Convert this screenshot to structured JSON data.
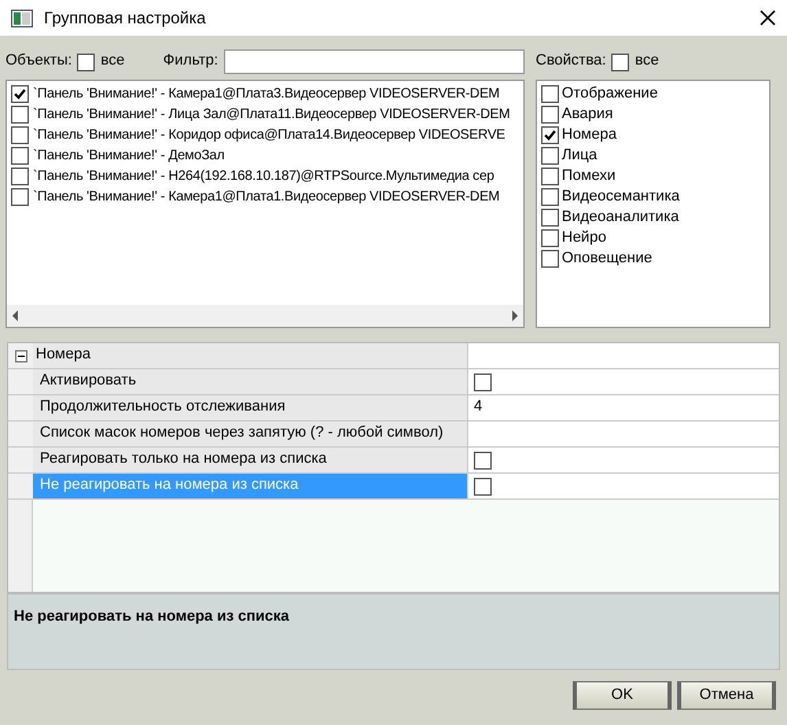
{
  "window": {
    "title": "Групповая настройка"
  },
  "objects": {
    "label": "Объекты:",
    "all_label": "все",
    "all_checked": false,
    "filter_label": "Фильтр:",
    "items": [
      {
        "label": "`Панель 'Внимание!' - Камера1@Плата3.Видеосервер VIDEOSERVER-DEM",
        "checked": true
      },
      {
        "label": "`Панель 'Внимание!' - Лица Зал@Плата11.Видеосервер VIDEOSERVER-DEM",
        "checked": false
      },
      {
        "label": "`Панель 'Внимание!' - Коридор офиса@Плата14.Видеосервер VIDEOSERVE",
        "checked": false
      },
      {
        "label": "`Панель 'Внимание!' - ДемоЗал",
        "checked": false
      },
      {
        "label": "`Панель 'Внимание!' - H264(192.168.10.187)@RTPSource.Мультимедиа сер",
        "checked": false
      },
      {
        "label": "`Панель 'Внимание!' - Камера1@Плата1.Видеосервер VIDEOSERVER-DEM",
        "checked": false
      }
    ]
  },
  "properties": {
    "label": "Свойства:",
    "all_label": "все",
    "all_checked": false,
    "items": [
      {
        "label": "Отображение",
        "checked": false
      },
      {
        "label": "Авария",
        "checked": false
      },
      {
        "label": "Номера",
        "checked": true
      },
      {
        "label": "Лица",
        "checked": false
      },
      {
        "label": "Помехи",
        "checked": false
      },
      {
        "label": "Видеосемантика",
        "checked": false
      },
      {
        "label": "Видеоаналитика",
        "checked": false
      },
      {
        "label": "Нейро",
        "checked": false
      },
      {
        "label": "Оповещение",
        "checked": false
      }
    ]
  },
  "property_grid": {
    "category": {
      "label": "Номера",
      "expanded": true
    },
    "rows": [
      {
        "name": "Активировать",
        "kind": "checkbox",
        "checked": false,
        "selected": false
      },
      {
        "name": "Продолжительность отслеживания",
        "kind": "text",
        "value": "4",
        "selected": false
      },
      {
        "name": "Список масок номеров через запятую (? - любой символ)",
        "kind": "text",
        "selected": false
      },
      {
        "name": "Реагировать только на номера из списка",
        "kind": "checkbox",
        "checked": false,
        "selected": false
      },
      {
        "name": "Не реагировать на номера из списка",
        "kind": "checkbox",
        "checked": false,
        "selected": true
      }
    ]
  },
  "description": "Не реагировать на номера из списка",
  "buttons": [
    "OK",
    "Отмена"
  ]
}
